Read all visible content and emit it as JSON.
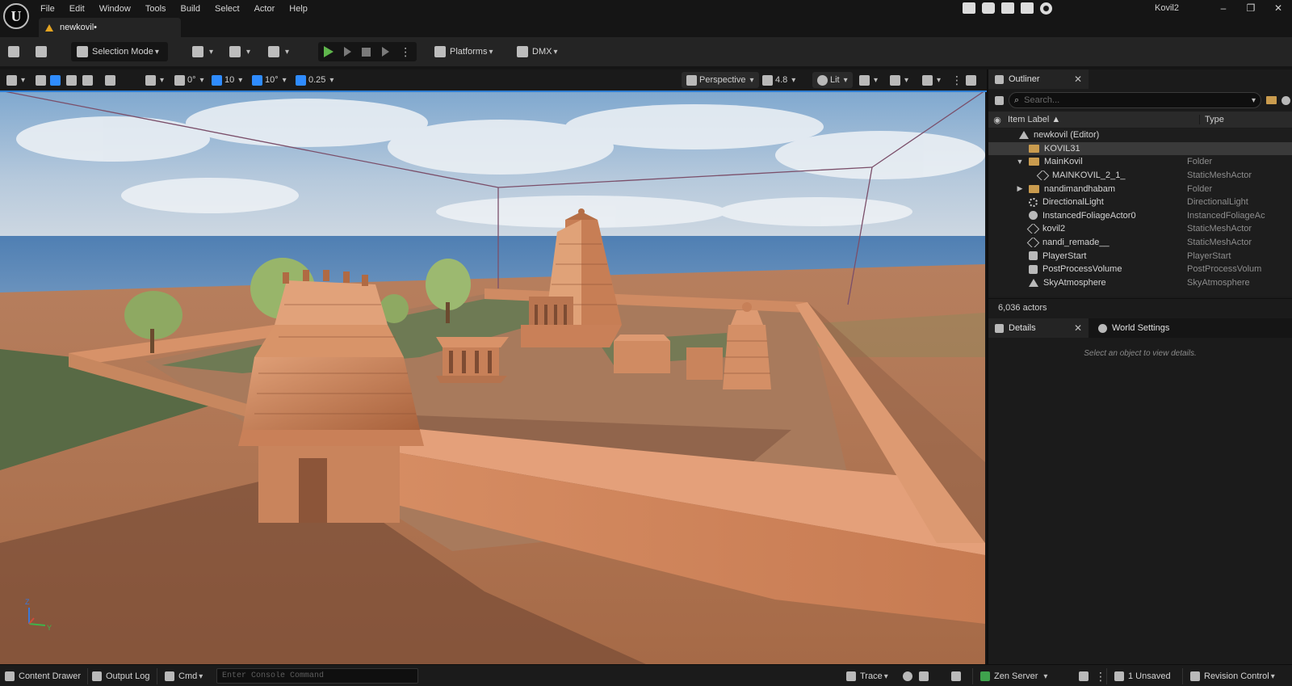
{
  "window": {
    "logo": "U",
    "project_name": "Kovil2",
    "menu": [
      "File",
      "Edit",
      "Window",
      "Tools",
      "Build",
      "Select",
      "Actor",
      "Help"
    ],
    "doc_tab": "newkovil•",
    "controls": [
      "–",
      "❐",
      "✕"
    ]
  },
  "toolbar": {
    "selection_mode": "Selection Mode",
    "platforms": "Platforms",
    "dmx": "DMX"
  },
  "viewport_toolbar": {
    "rotate_snap": "0°",
    "grid_snap": "10",
    "angle_snap": "10°",
    "scale_snap": "0.25",
    "view_mode": "Perspective",
    "camera_speed": "4.8",
    "lighting": "Lit"
  },
  "outliner": {
    "tab": "Outliner",
    "search_placeholder": "Search...",
    "col_label": "Item Label ▲",
    "col_type": "Type",
    "rows": [
      {
        "label": "newkovil (Editor)",
        "type": "",
        "icon": "world-icon",
        "indent": 1,
        "exp": ""
      },
      {
        "label": "KOVIL31",
        "type": "",
        "icon": "folder-icon",
        "indent": 2,
        "exp": "",
        "selected": true
      },
      {
        "label": "MainKovil",
        "type": "Folder",
        "icon": "folder-icon",
        "indent": 2,
        "exp": "▼"
      },
      {
        "label": "MAINKOVIL_2_1_",
        "type": "StaticMeshActor",
        "icon": "mesh-icon",
        "indent": 3,
        "exp": ""
      },
      {
        "label": "nandimandhabam",
        "type": "Folder",
        "icon": "folder-icon",
        "indent": 2,
        "exp": "▶"
      },
      {
        "label": "DirectionalLight",
        "type": "DirectionalLight",
        "icon": "light-icon",
        "indent": 2,
        "exp": ""
      },
      {
        "label": "InstancedFoliageActor0",
        "type": "InstancedFoliageAc",
        "icon": "sphere-icon",
        "indent": 2,
        "exp": ""
      },
      {
        "label": "kovil2",
        "type": "StaticMeshActor",
        "icon": "mesh-icon",
        "indent": 2,
        "exp": ""
      },
      {
        "label": "nandi_remade__",
        "type": "StaticMeshActor",
        "icon": "mesh-icon",
        "indent": 2,
        "exp": ""
      },
      {
        "label": "PlayerStart",
        "type": "PlayerStart",
        "icon": "generic-icon",
        "indent": 2,
        "exp": ""
      },
      {
        "label": "PostProcessVolume",
        "type": "PostProcessVolum",
        "icon": "generic-icon",
        "indent": 2,
        "exp": ""
      },
      {
        "label": "SkyAtmosphere",
        "type": "SkyAtmosphere",
        "icon": "tri-icon",
        "indent": 2,
        "exp": ""
      }
    ],
    "actor_count": "6,036 actors"
  },
  "details": {
    "tab": "Details",
    "world_tab": "World Settings",
    "hint": "Select an object to view details."
  },
  "statusbar": {
    "content_drawer": "Content Drawer",
    "output_log": "Output Log",
    "cmd": "Cmd",
    "console_placeholder": "Enter Console Command",
    "trace": "Trace",
    "zen_server": "Zen Server",
    "unsaved": "1 Unsaved",
    "revision_control": "Revision Control"
  },
  "gizmo": {
    "z": "Z",
    "y": "Y"
  },
  "colors": {
    "accent_blue": "#2d7dd2",
    "play_green": "#5fb64c",
    "folder": "#c99b4e",
    "warning": "#e5a421"
  }
}
